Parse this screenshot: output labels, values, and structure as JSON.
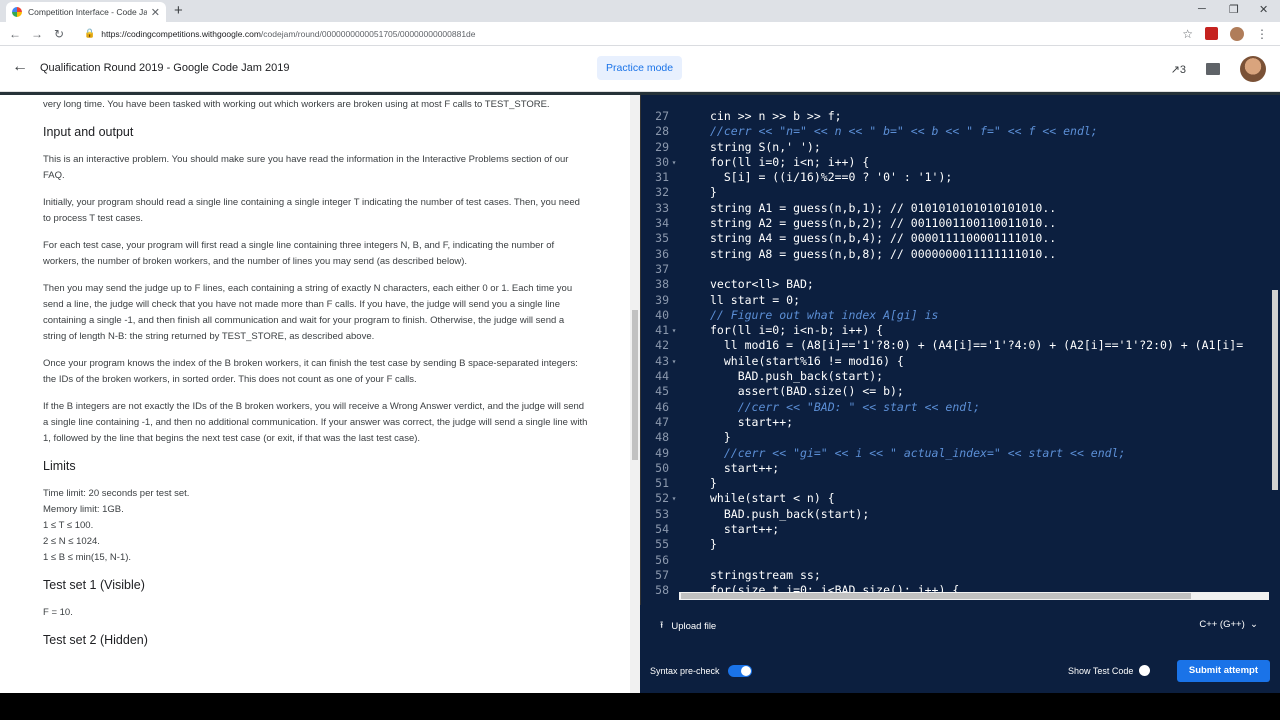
{
  "browser": {
    "tab_title": "Competition Interface - Code Jam",
    "tab_close": "✕",
    "new_tab": "+",
    "url_host": "https://codingcompetitions.withgoogle.com",
    "url_path": "/codejam/round/0000000000051705/00000000000881de",
    "minimize": "─",
    "maximize": "❐",
    "close": "✕"
  },
  "header": {
    "back": "←",
    "title": "Qualification Round 2019 - Google Code Jam 2019",
    "practice_mode": "Practice mode",
    "trend_count": "↗3"
  },
  "problem": {
    "p1": "very long time. You have been tasked with working out which workers are broken using at most F calls to TEST_STORE.",
    "h_io": "Input and output",
    "p2": "This is an interactive problem. You should make sure you have read the information in the Interactive Problems section of our FAQ.",
    "p3": "Initially, your program should read a single line containing a single integer T indicating the number of test cases. Then, you need to process T test cases.",
    "p4": "For each test case, your program will first read a single line containing three integers N, B, and F, indicating the number of workers, the number of broken workers, and the number of lines you may send (as described below).",
    "p5": "Then you may send the judge up to F lines, each containing a string of exactly N characters, each either 0 or 1. Each time you send a line, the judge will check that you have not made more than F calls. If you have, the judge will send you a single line containing a single -1, and then finish all communication and wait for your program to finish. Otherwise, the judge will send a string of length N-B: the string returned by TEST_STORE, as described above.",
    "p6": "Once your program knows the index of the B broken workers, it can finish the test case by sending B space-separated integers: the IDs of the broken workers, in sorted order. This does not count as one of your F calls.",
    "p7": "If the B integers are not exactly the IDs of the B broken workers, you will receive a Wrong Answer verdict, and the judge will send a single line containing -1, and then no additional communication. If your answer was correct, the judge will send a single line with 1, followed by the line that begins the next test case (or exit, if that was the last test case).",
    "h_limits": "Limits",
    "limits": [
      "Time limit: 20 seconds per test set.",
      "Memory limit: 1GB.",
      "1 ≤ T ≤ 100.",
      "2 ≤ N ≤ 1024.",
      "1 ≤ B ≤ min(15, N-1)."
    ],
    "h_ts1": "Test set 1 (Visible)",
    "ts1": "F = 10.",
    "h_ts2": "Test set 2 (Hidden)"
  },
  "code_lines": [
    {
      "n": "27",
      "t": "cin >> n >> b >> f;",
      "c": false
    },
    {
      "n": "28",
      "t": "//cerr << \"n=\" << n << \" b=\" << b << \" f=\" << f << endl;",
      "c": true
    },
    {
      "n": "29",
      "t": "string S(n,' ');",
      "c": false
    },
    {
      "n": "30",
      "t": "for(ll i=0; i<n; i++) {",
      "c": false,
      "f": true
    },
    {
      "n": "31",
      "t": "  S[i] = ((i/16)%2==0 ? '0' : '1');",
      "c": false
    },
    {
      "n": "32",
      "t": "}",
      "c": false
    },
    {
      "n": "33",
      "t": "string A1 = guess(n,b,1); // 0101010101010101010..",
      "c": false
    },
    {
      "n": "34",
      "t": "string A2 = guess(n,b,2); // 0011001100110011010..",
      "c": false
    },
    {
      "n": "35",
      "t": "string A4 = guess(n,b,4); // 0000111100001111010..",
      "c": false
    },
    {
      "n": "36",
      "t": "string A8 = guess(n,b,8); // 0000000011111111010..",
      "c": false
    },
    {
      "n": "37",
      "t": "",
      "c": false
    },
    {
      "n": "38",
      "t": "vector<ll> BAD;",
      "c": false
    },
    {
      "n": "39",
      "t": "ll start = 0;",
      "c": false
    },
    {
      "n": "40",
      "t": "// Figure out what index A[gi] is",
      "c": true
    },
    {
      "n": "41",
      "t": "for(ll i=0; i<n-b; i++) {",
      "c": false,
      "f": true
    },
    {
      "n": "42",
      "t": "  ll mod16 = (A8[i]=='1'?8:0) + (A4[i]=='1'?4:0) + (A2[i]=='1'?2:0) + (A1[i]=",
      "c": false
    },
    {
      "n": "43",
      "t": "  while(start%16 != mod16) {",
      "c": false,
      "f": true
    },
    {
      "n": "44",
      "t": "    BAD.push_back(start);",
      "c": false
    },
    {
      "n": "45",
      "t": "    assert(BAD.size() <= b);",
      "c": false
    },
    {
      "n": "46",
      "t": "    //cerr << \"BAD: \" << start << endl;",
      "c": true
    },
    {
      "n": "47",
      "t": "    start++;",
      "c": false
    },
    {
      "n": "48",
      "t": "  }",
      "c": false
    },
    {
      "n": "49",
      "t": "  //cerr << \"gi=\" << i << \" actual_index=\" << start << endl;",
      "c": true
    },
    {
      "n": "50",
      "t": "  start++;",
      "c": false
    },
    {
      "n": "51",
      "t": "}",
      "c": false
    },
    {
      "n": "52",
      "t": "while(start < n) {",
      "c": false,
      "f": true
    },
    {
      "n": "53",
      "t": "  BAD.push_back(start);",
      "c": false
    },
    {
      "n": "54",
      "t": "  start++;",
      "c": false
    },
    {
      "n": "55",
      "t": "}",
      "c": false
    },
    {
      "n": "56",
      "t": "",
      "c": false
    },
    {
      "n": "57",
      "t": "stringstream ss;",
      "c": false
    },
    {
      "n": "58",
      "t": "for(size_t i=0; i<BAD.size(); i++) {",
      "c": false
    }
  ],
  "footer": {
    "upload": "Upload file",
    "language": "C++ (G++)",
    "syntax_precheck": "Syntax pre-check",
    "show_test_code": "Show Test Code",
    "submit": "Submit attempt"
  },
  "colors": {
    "accent": "#1a73e8",
    "editor_bg": "#0c1f3f",
    "comment": "#5c8fd6"
  }
}
